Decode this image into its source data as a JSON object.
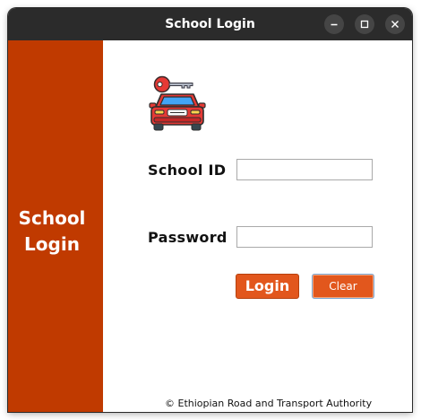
{
  "window": {
    "title": "School Login"
  },
  "sidebar": {
    "line1": "School",
    "line2": "Login"
  },
  "form": {
    "school_id_label": "School ID",
    "school_id_value": "",
    "password_label": "Password",
    "password_value": "",
    "login_label": "Login",
    "clear_label": "Clear"
  },
  "footer": {
    "text": "© Ethiopian Road and Transport Authority"
  },
  "icons": {
    "logo": "car-with-key-icon",
    "minimize": "minimize-icon",
    "maximize": "maximize-icon",
    "close": "close-icon"
  },
  "colors": {
    "sidebar": "#c03a00",
    "button": "#e2571d",
    "titlebar": "#2b2b2b"
  }
}
